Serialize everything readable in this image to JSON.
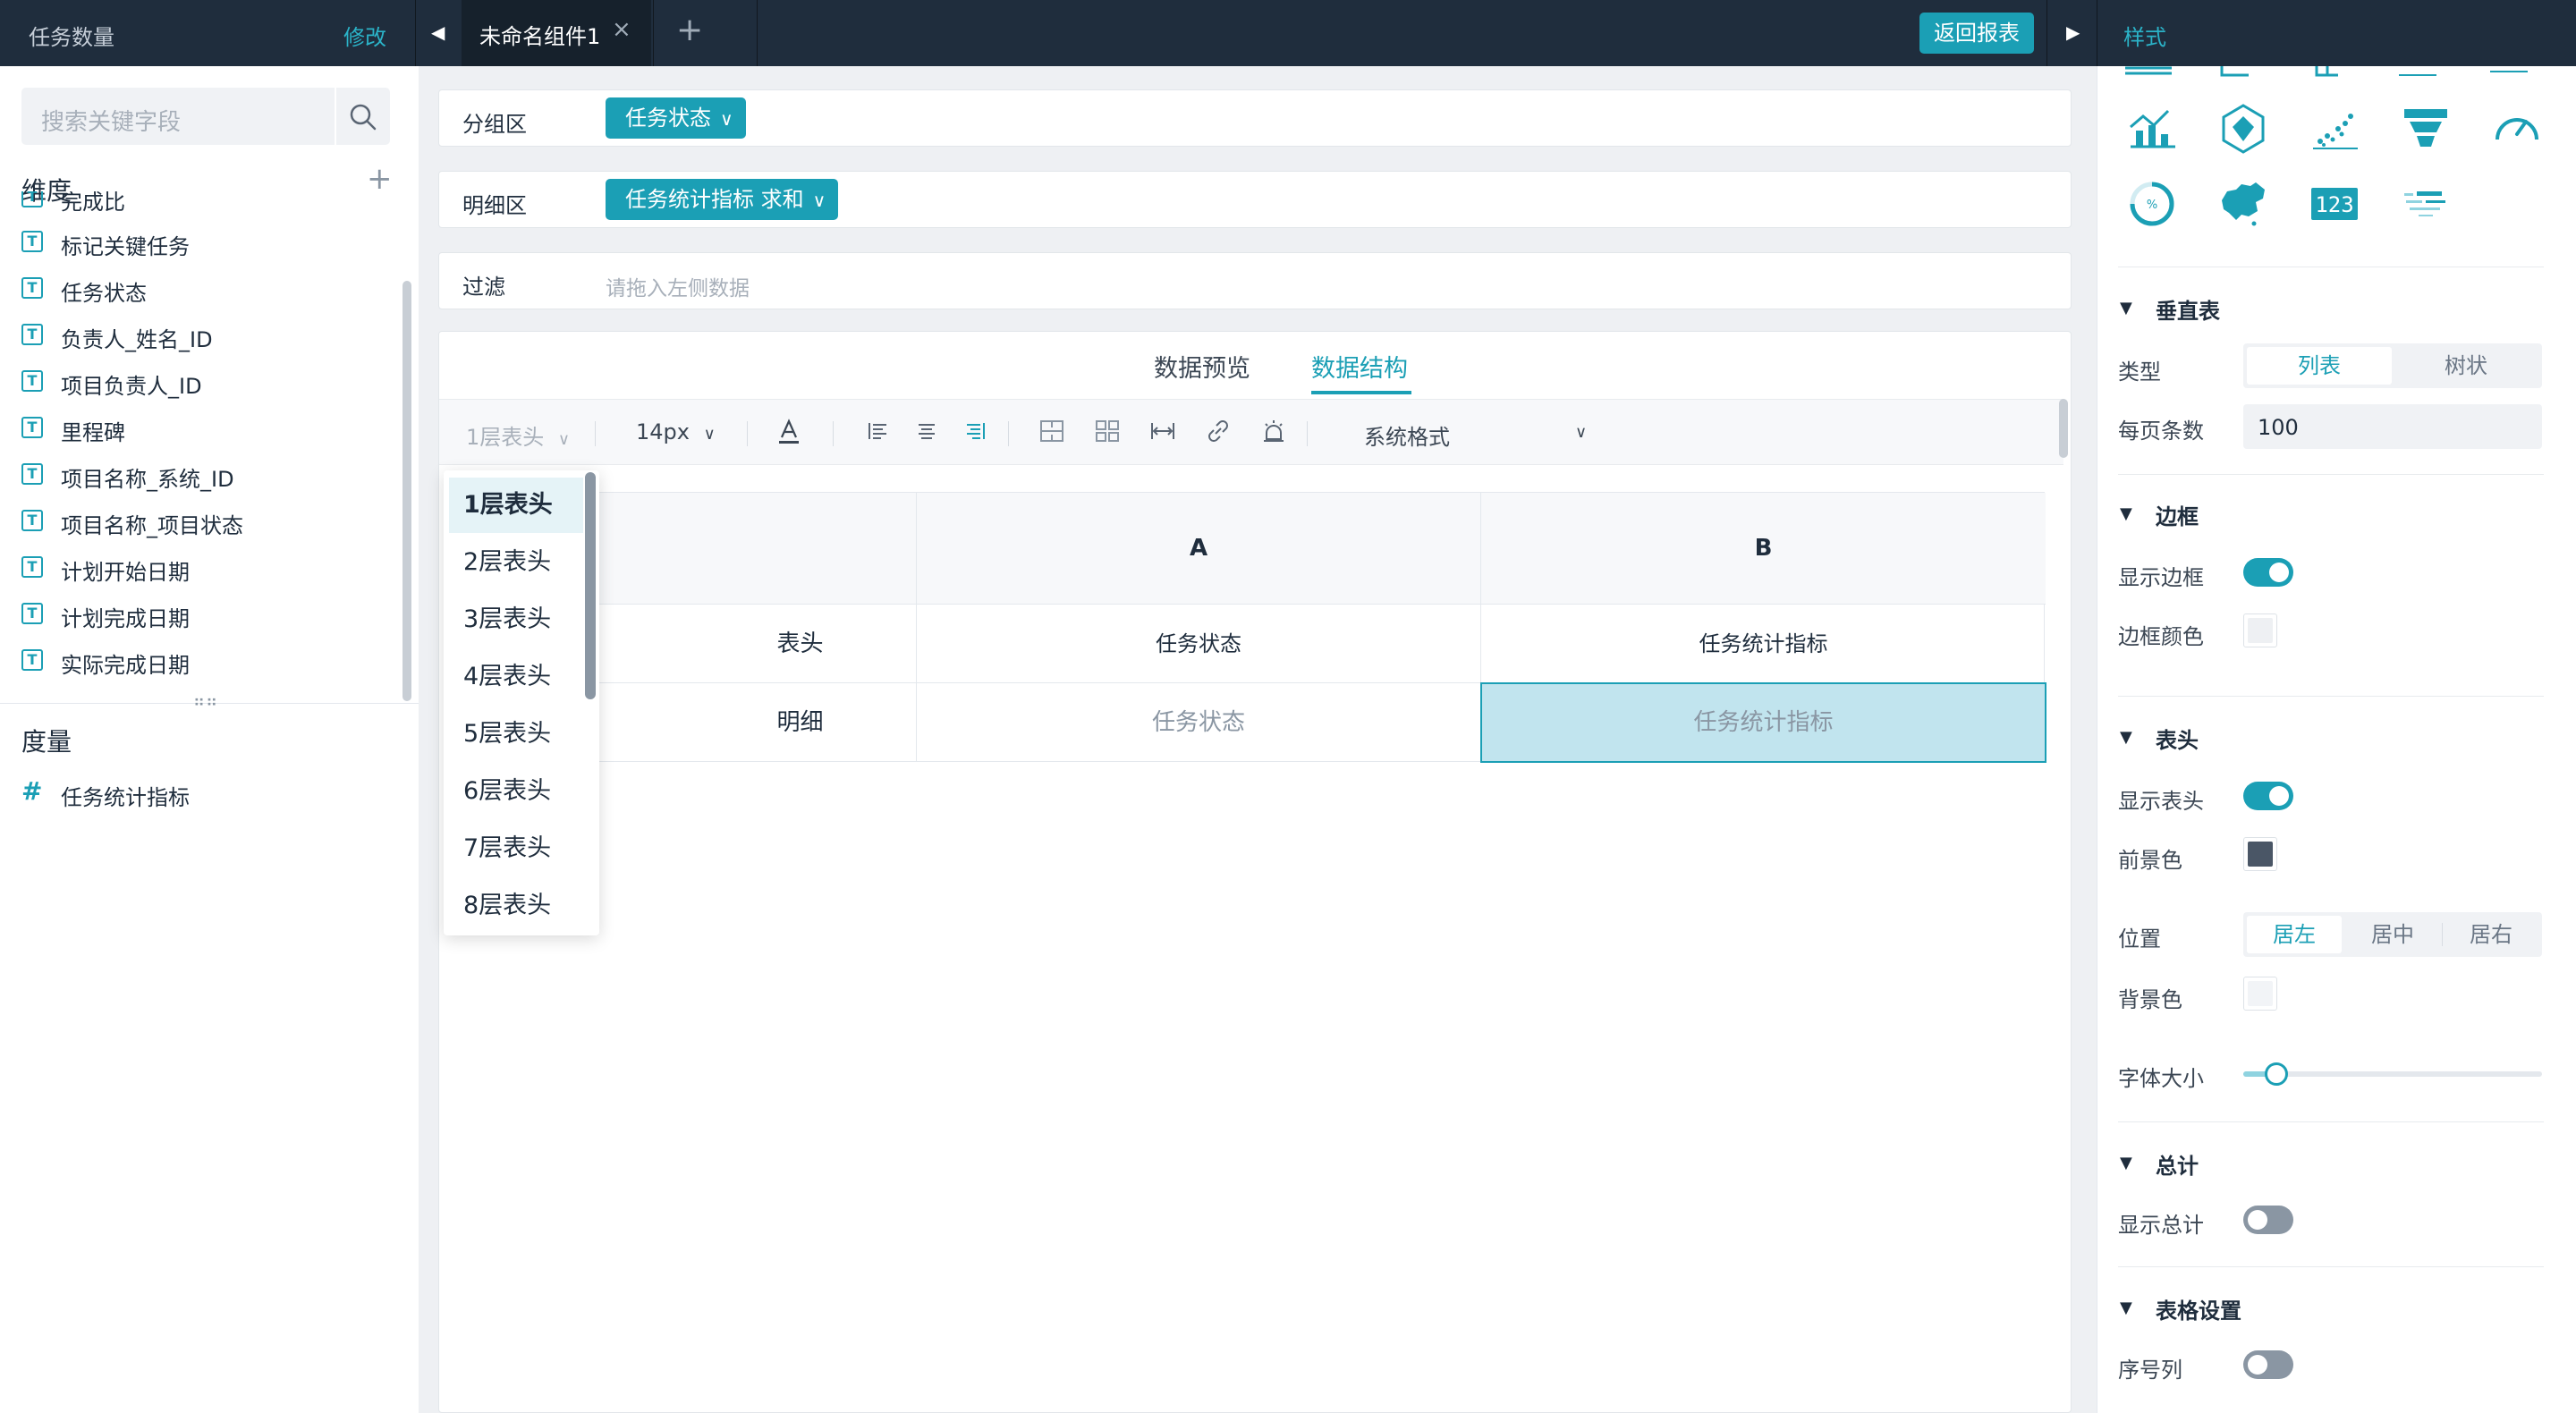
{
  "topbar": {
    "left_title": "任务数量",
    "edit_label": "修改",
    "tab_label": "未命名组件1",
    "back_button": "返回报表",
    "right_tab": "样式"
  },
  "left": {
    "search_placeholder": "搜索关键字段",
    "dimension_title": "维度",
    "dimension_fields": [
      "完成比",
      "标记关键任务",
      "任务状态",
      "负责人_姓名_ID",
      "项目负责人_ID",
      "里程碑",
      "项目名称_系统_ID",
      "项目名称_项目状态",
      "计划开始日期",
      "计划完成日期",
      "实际完成日期"
    ],
    "measure_title": "度量",
    "measure_fields": [
      "任务统计指标"
    ]
  },
  "zones": {
    "group_label": "分组区",
    "group_pill": "任务状态",
    "detail_label": "明细区",
    "detail_pill": "任务统计指标  求和",
    "filter_label": "过滤",
    "filter_placeholder": "请拖入左侧数据"
  },
  "view_tabs": {
    "preview": "数据预览",
    "structure": "数据结构",
    "active": "数据结构"
  },
  "toolbar": {
    "header_levels": "1层表头",
    "font_size": "14px",
    "format": "系统格式"
  },
  "dropdown": {
    "items": [
      "1层表头",
      "2层表头",
      "3层表头",
      "4层表头",
      "5层表头",
      "6层表头",
      "7层表头",
      "8层表头"
    ],
    "selected": "1层表头"
  },
  "table": {
    "col_letters": [
      "A",
      "B"
    ],
    "header_row_label": "表头",
    "header_values": [
      "任务状态",
      "任务统计指标"
    ],
    "detail_row_label": "明细",
    "detail_values": [
      "任务状态",
      "任务统计指标"
    ]
  },
  "right": {
    "vertical_table": {
      "title": "垂直表",
      "type_label": "类型",
      "type_options": [
        "列表",
        "树状"
      ],
      "type_selected": "列表",
      "page_size_label": "每页条数",
      "page_size_value": "100"
    },
    "border": {
      "title": "边框",
      "show_label": "显示边框",
      "show": true,
      "color_label": "边框颜色",
      "color": "#eef0f3"
    },
    "header": {
      "title": "表头",
      "show_label": "显示表头",
      "show": true,
      "fg_label": "前景色",
      "fg_color": "#4a5666",
      "position_label": "位置",
      "position_options": [
        "居左",
        "居中",
        "居右"
      ],
      "position_selected": "居左",
      "bg_label": "背景色",
      "bg_color": "#f2f4f7",
      "font_size_label": "字体大小",
      "font_size_level": 0.11
    },
    "total": {
      "title": "总计",
      "show_label": "显示总计",
      "show": false
    },
    "table_settings": {
      "title": "表格设置",
      "index_col_label": "序号列",
      "index_col": false
    }
  },
  "colors": {
    "accent": "#1b9fb5",
    "topbar": "#1f2d3d",
    "selected_cell": "#c1e4ee"
  }
}
